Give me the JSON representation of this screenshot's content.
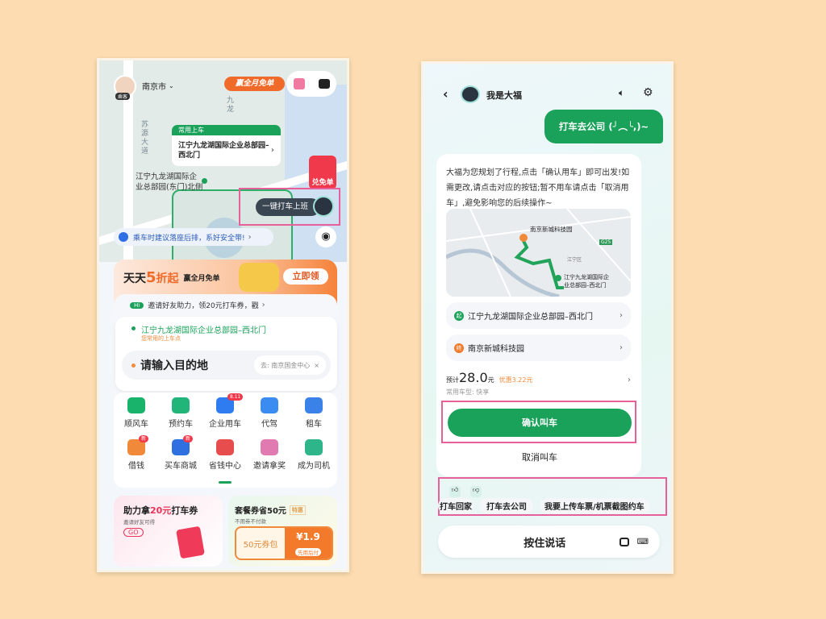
{
  "left": {
    "city": "南京市",
    "avatar_badge": "乘客",
    "promo_badge": "赢全月免单",
    "pickup_popup": {
      "header": "常用上车",
      "place": "江宁九龙湖国际企业总部园–西北门"
    },
    "map_label": "江宁九龙湖国际企业总部园(东门)北侧",
    "map_road_label": "苏源大道",
    "map_road_label2": "九龙",
    "red_envelope": "兑免单",
    "one_tap_button": "一键打车上班",
    "safety_tip": "乘车时建议落座后排，系好安全带!",
    "banner": {
      "title_a": "天天",
      "title_num": "5",
      "title_b": "折起",
      "subtitle": "赢全月免单",
      "cta": "立即领"
    },
    "invite": {
      "tag": "Hi",
      "text": "邀请好友助力，领20元打车券，戳"
    },
    "pickup": {
      "place": "江宁九龙湖国际企业总部园–西北门",
      "note": "您常用的上车点"
    },
    "destination": {
      "placeholder": "请输入目的地",
      "suggestion": "去: 南京国金中心"
    },
    "services_row1": [
      {
        "label": "顺风车",
        "icon": "carpool-car-icon",
        "color": "#19b36b"
      },
      {
        "label": "预约车",
        "icon": "alarm-clock-icon",
        "color": "#21b57a"
      },
      {
        "label": "企业用车",
        "icon": "building-icon",
        "color": "#2f7bf0",
        "badge": "8.11"
      },
      {
        "label": "代驾",
        "icon": "chauffeur-icon",
        "color": "#3a8cf0"
      },
      {
        "label": "租车",
        "icon": "rental-car-icon",
        "color": "#3b82e8"
      }
    ],
    "services_row2": [
      {
        "label": "借钱",
        "icon": "money-bag-icon",
        "color": "#f08a3a",
        "badge": "新"
      },
      {
        "label": "买车商城",
        "icon": "car-shop-icon",
        "color": "#2f6fe0",
        "badge": "新"
      },
      {
        "label": "省钱中心",
        "icon": "savings-icon",
        "color": "#e84d4d"
      },
      {
        "label": "邀请拿奖",
        "icon": "invite-people-icon",
        "color": "#e07ab0"
      },
      {
        "label": "成为司机",
        "icon": "driver-icon",
        "color": "#2fb58a"
      }
    ],
    "promo_left": {
      "title_a": "助力拿",
      "title_hl": "20元",
      "title_b": "打车券",
      "sub": "邀请好友可得",
      "cta": "GO"
    },
    "promo_right": {
      "title": "套餐券省50元",
      "tag": "特惠",
      "sub": "不用券不付款",
      "pack": "50元券包",
      "price": "¥1.9",
      "price_note": "先用后付"
    }
  },
  "right": {
    "title": "我是大福",
    "user_message": "打车去公司 (╯︵╰,)~",
    "bot_message": "大福为您规划了行程,点击「确认用车」即可出发!如需更改,请点击对应的按钮;暂不用车请点击「取消用车」,避免影响您的后续操作~",
    "map": {
      "dest_label": "南京新城科技园",
      "start_label": "江宁九龙湖国际企业总部园–西北门",
      "highway": "G25",
      "district": "江宁区"
    },
    "start": {
      "tag": "起",
      "place": "江宁九龙湖国际企业总部园–西北门"
    },
    "end": {
      "tag": "终",
      "place": "南京新城科技园"
    },
    "price": {
      "prefix": "预计",
      "amount": "28.0",
      "unit": "元",
      "discount": "优惠3.22元",
      "car_type": "常用车型: 快享"
    },
    "confirm_button": "确认叫车",
    "cancel_button": "取消叫车",
    "quick_replies": [
      "打车回家",
      "打车去公司",
      "我要上传车票/机票截图约车"
    ],
    "voice_button": "按住说话",
    "accent": "#1aa25a"
  }
}
